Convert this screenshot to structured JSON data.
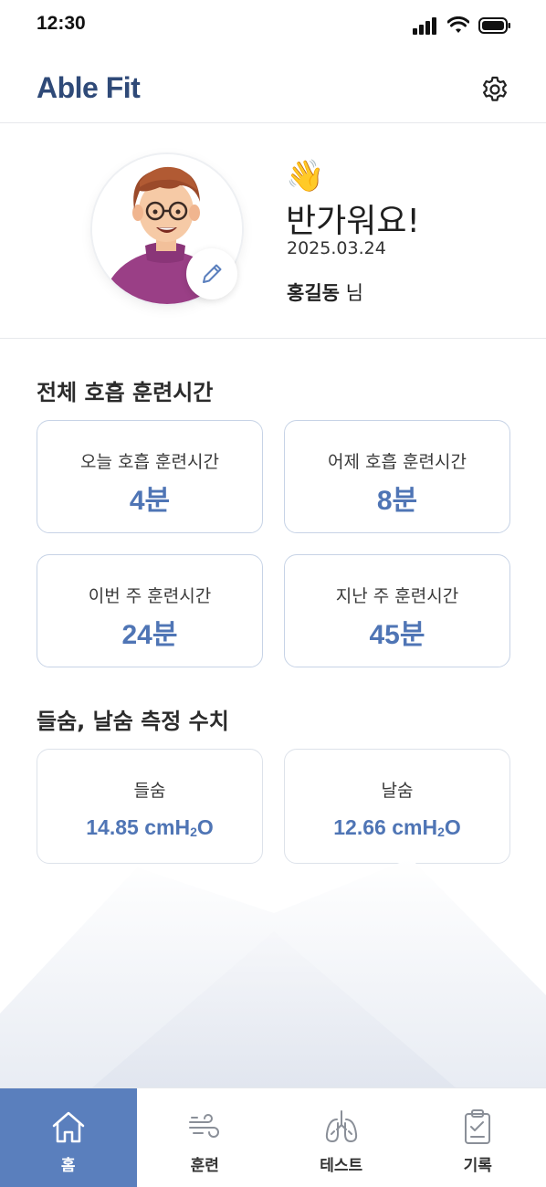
{
  "status_bar": {
    "time": "12:30"
  },
  "header": {
    "app_name": "Able Fit",
    "settings_icon": "gear-icon"
  },
  "profile": {
    "wave_emoji": "👋",
    "greeting": "반가워요!",
    "date": "2025.03.24",
    "user_name": "홍길동",
    "honorific": "님",
    "edit_icon": "pencil-icon"
  },
  "training_section": {
    "title": "전체 호흡 훈련시간",
    "cards": [
      {
        "label": "오늘 호흡 훈련시간",
        "value": "4분"
      },
      {
        "label": "어제 호흡 훈련시간",
        "value": "8분"
      },
      {
        "label": "이번 주 훈련시간",
        "value": "24분"
      },
      {
        "label": "지난 주 훈련시간",
        "value": "45분"
      }
    ]
  },
  "measure_section": {
    "title": "들숨, 날숨 측정 수치",
    "cards": [
      {
        "label": "들숨",
        "value": "14.85 cmH",
        "sub": "2",
        "unit_tail": "O"
      },
      {
        "label": "날숨",
        "value": "12.66 cmH",
        "sub": "2",
        "unit_tail": "O"
      }
    ]
  },
  "bottom_nav": {
    "items": [
      {
        "label": "홈",
        "icon": "home-icon",
        "active": true
      },
      {
        "label": "훈련",
        "icon": "wind-icon",
        "active": false
      },
      {
        "label": "테스트",
        "icon": "lungs-icon",
        "active": false
      },
      {
        "label": "기록",
        "icon": "clipboard-check-icon",
        "active": false
      }
    ]
  },
  "colors": {
    "accent": "#5a7fbd",
    "value_text": "#4f75b5",
    "logo": "#2f4a78",
    "card_border": "#c7d3e6"
  }
}
